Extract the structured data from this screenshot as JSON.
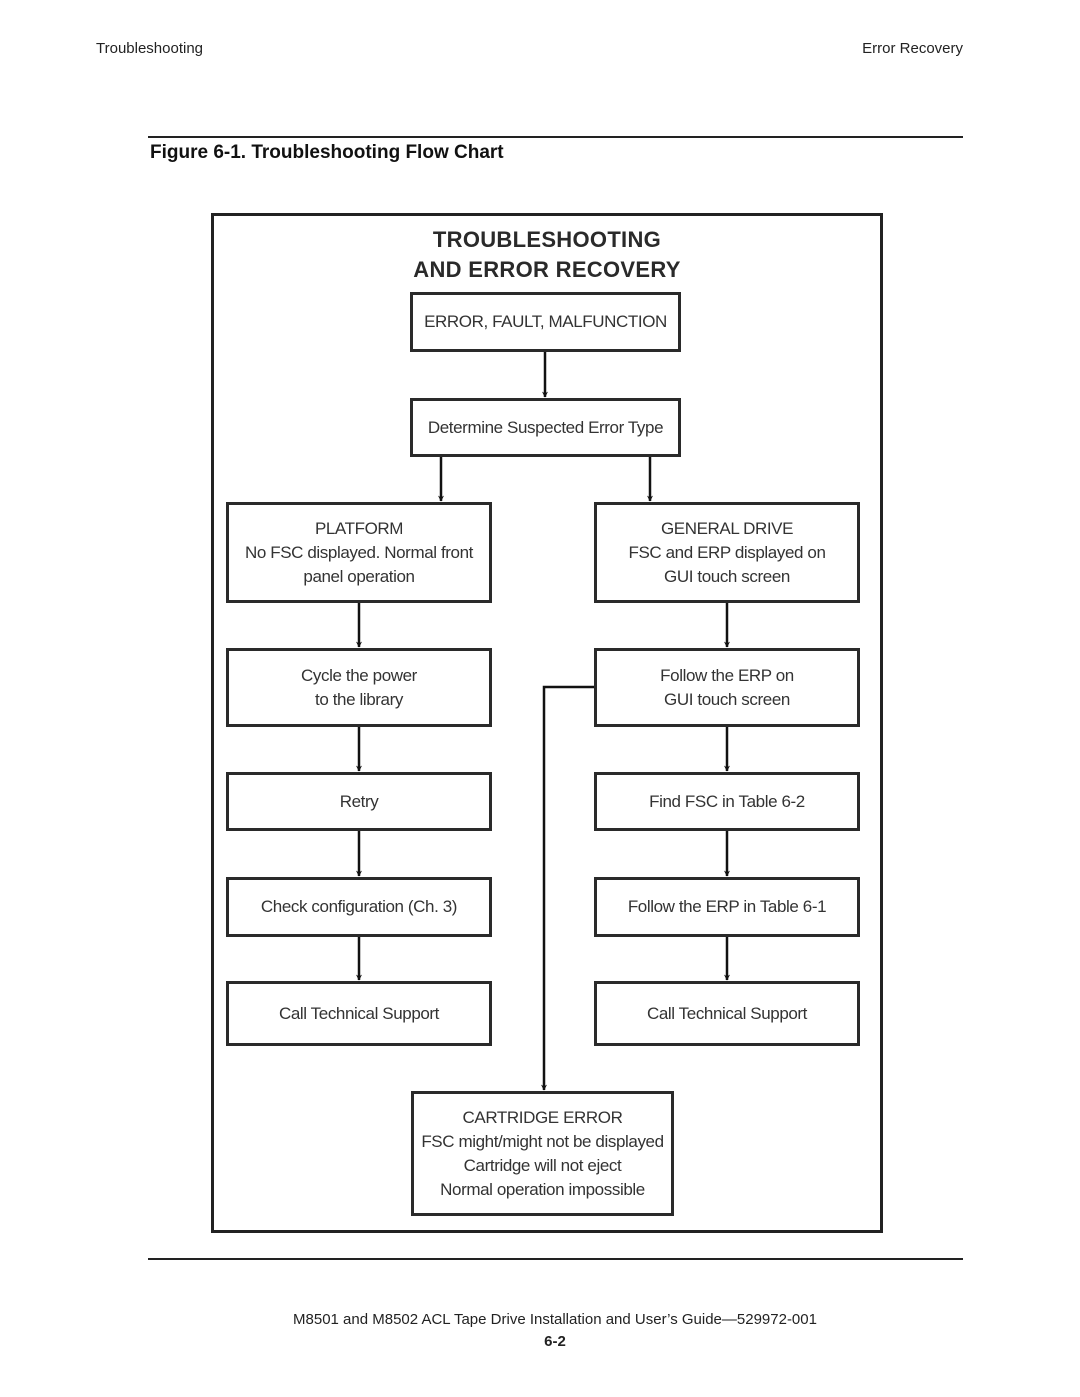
{
  "page_header": {
    "left": "Troubleshooting",
    "right": "Error Recovery"
  },
  "figure": {
    "title": "Figure 6-1.  Troubleshooting Flow Chart"
  },
  "flowchart": {
    "heading_line1": "TROUBLESHOOTING",
    "heading_line2": "AND ERROR RECOVERY",
    "nodes": {
      "start": {
        "lines": [
          "ERROR, FAULT, MALFUNCTION"
        ]
      },
      "determine": {
        "lines": [
          "Determine Suspected Error Type"
        ]
      },
      "platform": {
        "lines": [
          "PLATFORM",
          "No FSC displayed. Normal front",
          "panel operation"
        ]
      },
      "general_drive": {
        "lines": [
          "GENERAL DRIVE",
          "FSC and ERP displayed on",
          "GUI touch screen"
        ]
      },
      "cycle_power": {
        "lines": [
          "Cycle the power",
          "to the library"
        ]
      },
      "follow_erp_gui": {
        "lines": [
          "Follow the ERP on",
          "GUI touch screen"
        ]
      },
      "retry": {
        "lines": [
          "Retry"
        ]
      },
      "find_fsc": {
        "lines": [
          "Find FSC in Table 6-2"
        ]
      },
      "check_config": {
        "lines": [
          "Check configuration (Ch. 3)"
        ]
      },
      "follow_erp_table": {
        "lines": [
          "Follow the ERP in Table 6-1"
        ]
      },
      "call_support_left": {
        "lines": [
          "Call Technical Support"
        ]
      },
      "call_support_right": {
        "lines": [
          "Call Technical Support"
        ]
      },
      "cartridge_error": {
        "lines": [
          "CARTRIDGE ERROR",
          "FSC might/might not be displayed",
          "Cartridge will not eject",
          "Normal operation impossible"
        ]
      }
    },
    "edges": [
      [
        "start",
        "determine"
      ],
      [
        "determine",
        "platform"
      ],
      [
        "determine",
        "general_drive"
      ],
      [
        "platform",
        "cycle_power"
      ],
      [
        "cycle_power",
        "retry"
      ],
      [
        "retry",
        "check_config"
      ],
      [
        "check_config",
        "call_support_left"
      ],
      [
        "general_drive",
        "follow_erp_gui"
      ],
      [
        "follow_erp_gui",
        "find_fsc"
      ],
      [
        "find_fsc",
        "follow_erp_table"
      ],
      [
        "follow_erp_table",
        "call_support_right"
      ],
      [
        "follow_erp_gui",
        "cartridge_error"
      ]
    ]
  },
  "footer": {
    "guide": "M8501 and M8502 ACL Tape Drive Installation and User’s Guide—529972-001",
    "page": "6-2"
  }
}
